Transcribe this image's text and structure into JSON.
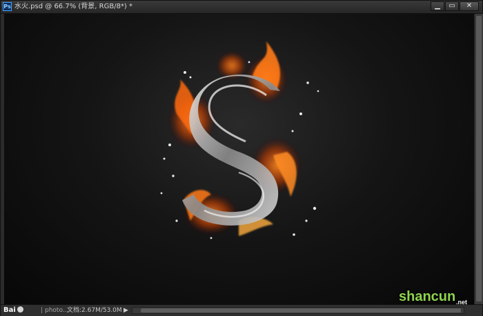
{
  "window": {
    "app_icon": "Ps",
    "title": "水火.psd @ 66.7% (背景, RGB/8*) *",
    "controls": {
      "minimize": "▁",
      "restore": "▭",
      "close": "✕"
    }
  },
  "canvas": {
    "description_icon": "fire-water-letter-s",
    "background_color": "#0d0d0d"
  },
  "status_bar": {
    "baidu_logo": "Bai",
    "separator": "|",
    "photo_label": "photo...",
    "doc_size": "文档:2.67M/53.0M",
    "arrow_icon": "triangle-right-icon"
  },
  "watermark": {
    "text": "shancun",
    "suffix": ".net",
    "color": "#8fd44f"
  }
}
